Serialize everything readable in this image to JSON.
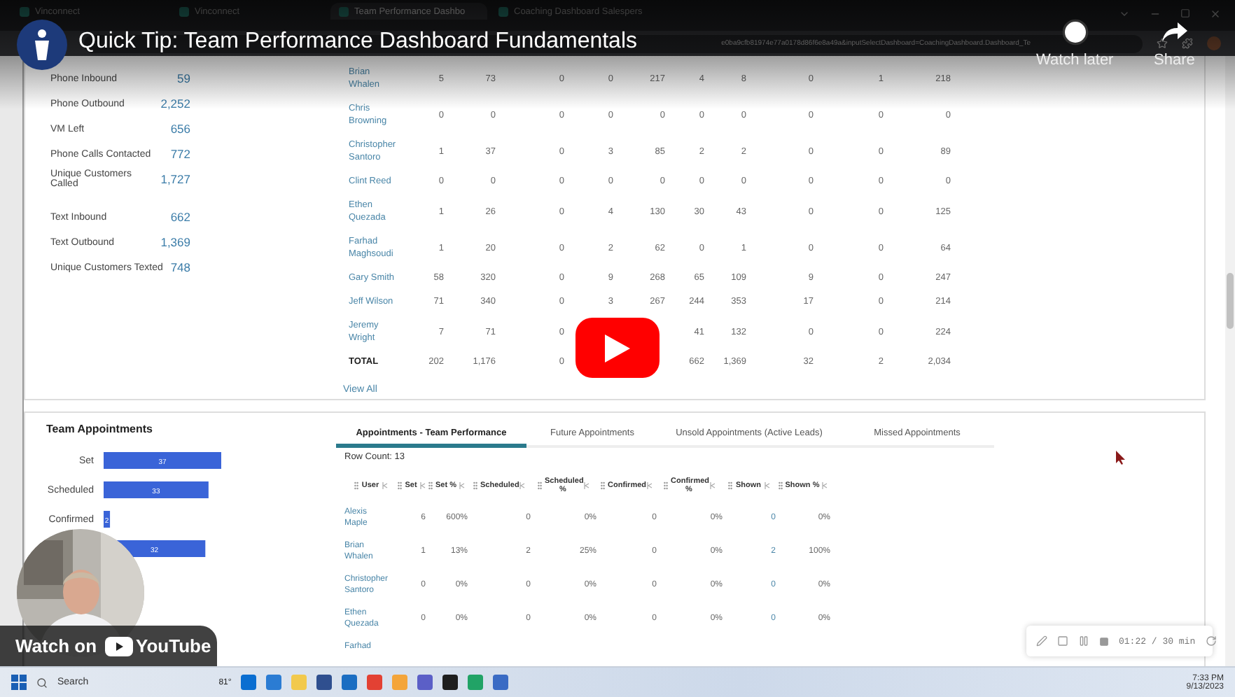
{
  "video": {
    "title": "Quick Tip: Team Performance Dashboard Fundamentals",
    "watch_later": "Watch later",
    "share": "Share",
    "watch_on": "Watch on",
    "youtube": "YouTube"
  },
  "browser": {
    "tabs": [
      {
        "title": "Vinconnect",
        "selected": false
      },
      {
        "title": "Vinconnect",
        "selected": false
      },
      {
        "title": "Team Performance Dashbo",
        "selected": true
      },
      {
        "title": "Coaching Dashboard Salespers",
        "selected": false
      }
    ],
    "url": "e0ba9cfb81974e77a0178d86f6e8a49a&inputSelectDashboard=CoachingDashboard.Dashboard_Te"
  },
  "metrics": [
    {
      "label": "Phone Inbound",
      "value": "59"
    },
    {
      "label": "Phone Outbound",
      "value": "2,252"
    },
    {
      "label": "VM Left",
      "value": "656"
    },
    {
      "label": "Phone Calls Contacted",
      "value": "772"
    },
    {
      "label": "Unique Customers Called",
      "value": "1,727"
    },
    {
      "label": "Text Inbound",
      "value": "662"
    },
    {
      "label": "Text Outbound",
      "value": "1,369"
    },
    {
      "label": "Unique Customers Texted",
      "value": "748"
    }
  ],
  "performance": {
    "rows": [
      {
        "name": "Brian Whalen",
        "cells": {
          "column_2": "5",
          "column_3": "73",
          "column_4": "0",
          "column_5": "0",
          "column_6": "217",
          "column_7": "4",
          "column_8": "8",
          "column_9": "0",
          "column_10": "1",
          "column_11": "218"
        }
      },
      {
        "name": "Chris Browning",
        "cells": {
          "column_2": "0",
          "column_3": "0",
          "column_4": "0",
          "column_5": "0",
          "column_6": "0",
          "column_7": "0",
          "column_8": "0",
          "column_9": "0",
          "column_10": "0",
          "column_11": "0"
        }
      },
      {
        "name": "Christopher Santoro",
        "cells": {
          "column_2": "1",
          "column_3": "37",
          "column_4": "0",
          "column_5": "3",
          "column_6": "85",
          "column_7": "2",
          "column_8": "2",
          "column_9": "0",
          "column_10": "0",
          "column_11": "89"
        }
      },
      {
        "name": "Clint Reed",
        "cells": {
          "column_2": "0",
          "column_3": "0",
          "column_4": "0",
          "column_5": "0",
          "column_6": "0",
          "column_7": "0",
          "column_8": "0",
          "column_9": "0",
          "column_10": "0",
          "column_11": "0"
        }
      },
      {
        "name": "Ethen Quezada",
        "cells": {
          "column_2": "1",
          "column_3": "26",
          "column_4": "0",
          "column_5": "4",
          "column_6": "130",
          "column_7": "30",
          "column_8": "43",
          "column_9": "0",
          "column_10": "0",
          "column_11": "125"
        }
      },
      {
        "name": "Farhad Maghsoudi",
        "cells": {
          "column_2": "1",
          "column_3": "20",
          "column_4": "0",
          "column_5": "2",
          "column_6": "62",
          "column_7": "0",
          "column_8": "1",
          "column_9": "0",
          "column_10": "0",
          "column_11": "64"
        }
      },
      {
        "name": "Gary Smith",
        "cells": {
          "column_2": "58",
          "column_3": "320",
          "column_4": "0",
          "column_5": "9",
          "column_6": "268",
          "column_7": "65",
          "column_8": "109",
          "column_9": "9",
          "column_10": "0",
          "column_11": "247"
        }
      },
      {
        "name": "Jeff Wilson",
        "cells": {
          "column_2": "71",
          "column_3": "340",
          "column_4": "0",
          "column_5": "3",
          "column_6": "267",
          "column_7": "244",
          "column_8": "353",
          "column_9": "17",
          "column_10": "0",
          "column_11": "214"
        }
      },
      {
        "name": "Jeremy Wright",
        "cells": {
          "column_2": "7",
          "column_3": "71",
          "column_4": "0",
          "column_7": "41",
          "column_8": "132",
          "column_9": "0",
          "column_10": "0",
          "column_11": "224"
        }
      }
    ],
    "total": {
      "label": "TOTAL",
      "cells": {
        "column_2": "202",
        "column_3": "1,176",
        "column_4": "0",
        "column_7": "662",
        "column_8": "1,369",
        "column_9": "32",
        "column_10": "2",
        "column_11": "2,034"
      }
    },
    "view_all": "View All"
  },
  "team_appointments": {
    "title": "Team Appointments",
    "chart_data": {
      "type": "bar",
      "orientation": "horizontal",
      "categories": [
        "Set",
        "Scheduled",
        "Confirmed",
        null
      ],
      "series": [
        {
          "color": "#3a64d8",
          "values": [
            37,
            33,
            2,
            32
          ]
        }
      ],
      "data_labels": true
    }
  },
  "appointments": {
    "tabs": [
      {
        "label": "Appointments - Team Performance",
        "selected": true
      },
      {
        "label": "Future Appointments",
        "selected": false
      },
      {
        "label": "Unsold Appointments (Active Leads)",
        "selected": false
      },
      {
        "label": "Missed Appointments",
        "selected": false
      }
    ],
    "row_count": "Row Count: 13",
    "columns": [
      "User",
      "Set",
      "Set %",
      "Scheduled",
      "Scheduled %",
      "Confirmed",
      "Confirmed %",
      "Shown",
      "Shown %"
    ],
    "rows": [
      {
        "user": "Alexis Maple",
        "values": [
          "6",
          "600%",
          "0",
          "0%",
          "0",
          "0%",
          "0",
          "0%"
        ]
      },
      {
        "user": "Brian Whalen",
        "values": [
          "1",
          "13%",
          "2",
          "25%",
          "0",
          "0%",
          "2",
          "100%"
        ]
      },
      {
        "user": "Christopher Santoro",
        "values": [
          "0",
          "0%",
          "0",
          "0%",
          "0",
          "0%",
          "0",
          "0%"
        ]
      },
      {
        "user": "Ethen Quezada",
        "values": [
          "0",
          "0%",
          "0",
          "0%",
          "0",
          "0%",
          "0",
          "0%"
        ]
      },
      {
        "user": "Farhad"
      }
    ]
  },
  "recorder": {
    "time": "01:22 / 30 min"
  },
  "taskbar": {
    "search": "Search",
    "weather": "81°",
    "time": "7:33 PM",
    "date": "9/13/2023"
  }
}
